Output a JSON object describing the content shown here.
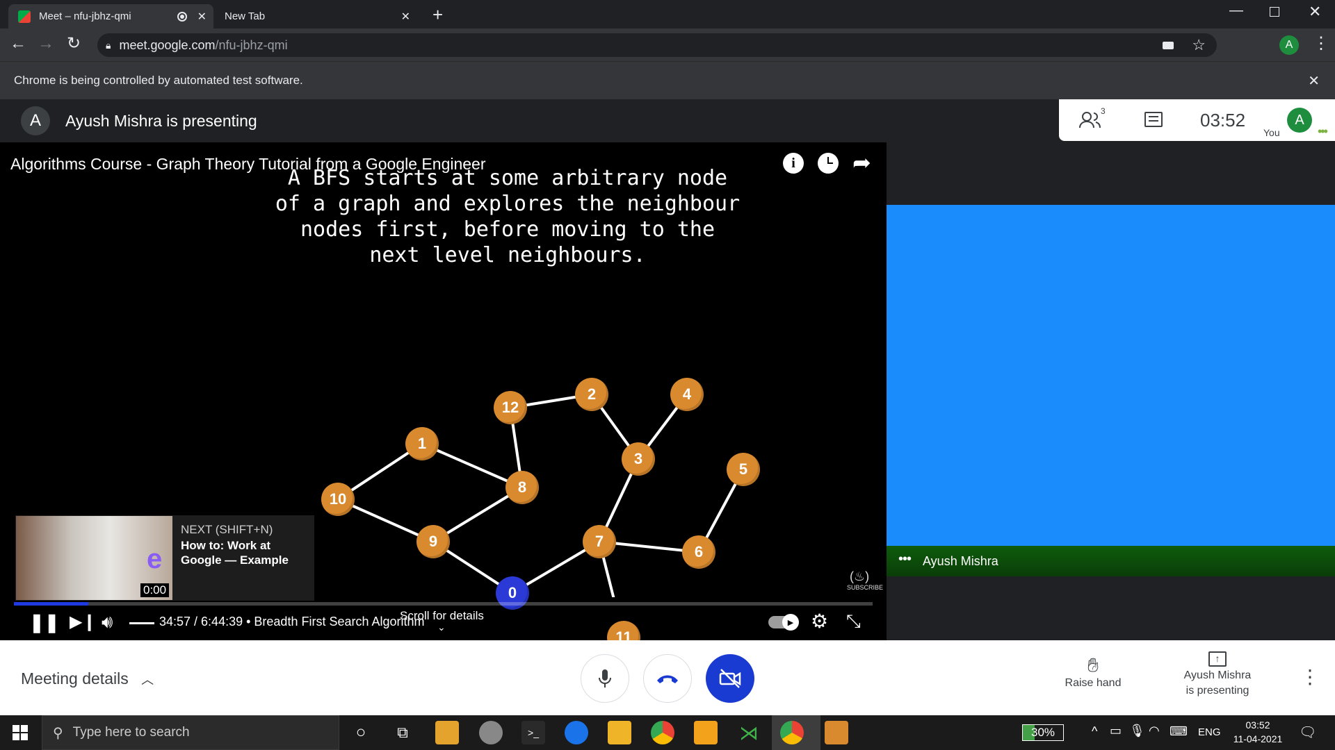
{
  "browser": {
    "tabs": [
      {
        "title": "Meet – nfu-jbhz-qmi"
      },
      {
        "title": "New Tab"
      }
    ],
    "url_host": "meet.google.com",
    "url_path": "/nfu-jbhz-qmi",
    "profile_initial": "A",
    "infobar_text": "Chrome is being controlled by automated test software."
  },
  "meet": {
    "presenter_initial": "A",
    "presenting_text": "Ayush Mishra is presenting",
    "participants_count": "3",
    "clock": "03:52",
    "you_label": "You",
    "self_initial": "A",
    "tile_name": "Ayush Mishra",
    "meeting_details": "Meeting details",
    "raise_hand": "Raise hand",
    "presenting_label_line1": "Ayush Mishra",
    "presenting_label_line2": "is presenting"
  },
  "video": {
    "title": "Algorithms Course - Graph Theory Tutorial from a Google Engineer",
    "caption_lines": [
      "A BFS starts at some arbitrary node",
      "of a graph and explores the neighbour",
      "nodes first, before moving to the",
      "next level neighbours."
    ],
    "graph_nodes": [
      "12",
      "2",
      "4",
      "1",
      "3",
      "5",
      "10",
      "8",
      "9",
      "7",
      "6",
      "0",
      "11"
    ],
    "next_label": "NEXT (SHIFT+N)",
    "next_title_line1": "How to: Work at",
    "next_title_line2": "Google — Example",
    "next_time": "0:00",
    "time_text": "34:57 / 6:44:39 • Breadth First Search Algorithm",
    "scroll_hint": "Scroll for details",
    "progress_fraction": 0.0865
  },
  "taskbar": {
    "search_placeholder": "Type here to search",
    "battery": "30%",
    "lang": "ENG",
    "time": "03:52",
    "date": "11-04-2021"
  },
  "colors": {
    "node_orange": "#d98a2e",
    "node_blue": "#2b3ad6",
    "tile_blue": "#1a8cfb",
    "meet_blue": "#1a3bd1"
  }
}
